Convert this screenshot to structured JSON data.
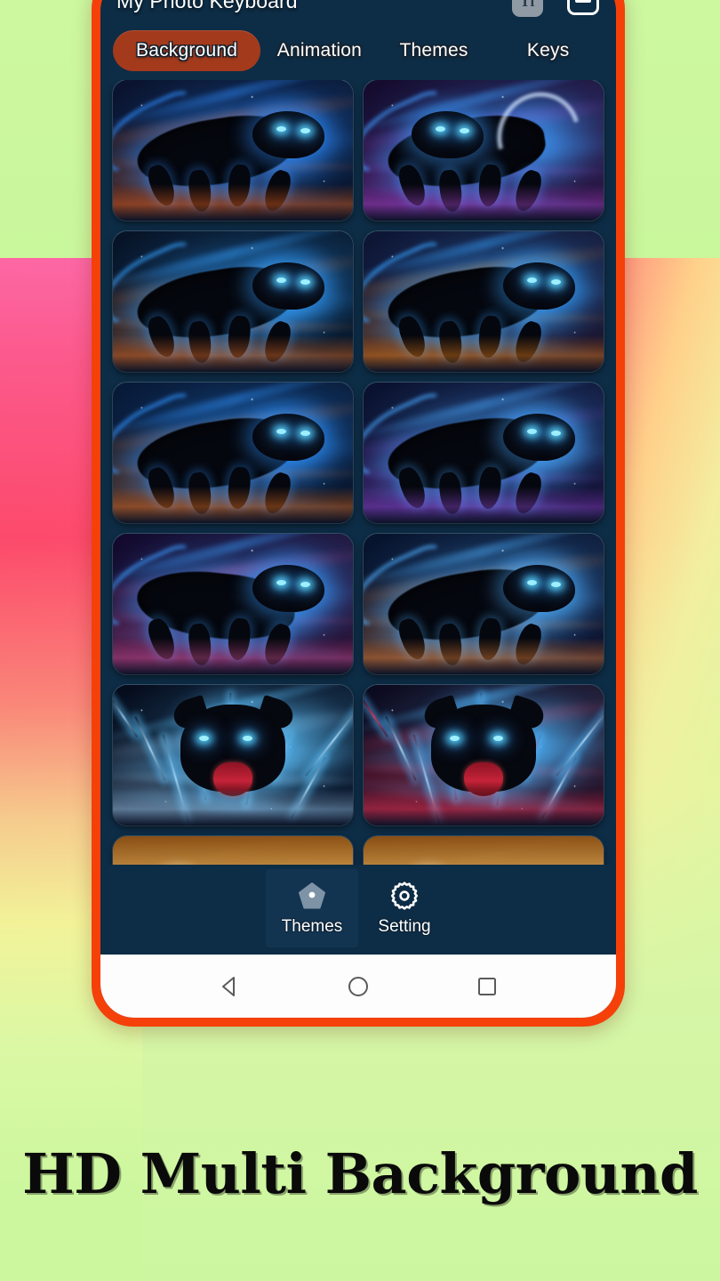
{
  "app": {
    "title": "My Photo Keyboard",
    "font_size_button_label": "Tf",
    "menu_icon": "hamburger-menu-icon",
    "font_icon": "font-size-icon"
  },
  "tabs": [
    {
      "label": "Background",
      "active": true
    },
    {
      "label": "Animation",
      "active": false
    },
    {
      "label": "Themes",
      "active": false
    },
    {
      "label": "Keys",
      "active": false
    }
  ],
  "grid": {
    "columns": 2,
    "items": [
      {
        "name": "neon-blue-panther-leaping",
        "sky_from": "#0a1430",
        "sky_to": "#061024",
        "glow": "#2f8dff",
        "accent": "#ff6a1e",
        "pose": "leap-right"
      },
      {
        "name": "cosmic-panther-crescent-moon",
        "sky_from": "#140b2e",
        "sky_to": "#2a0f3a",
        "glow": "#3f9dff",
        "accent": "#b24ad8",
        "pose": "moon"
      },
      {
        "name": "electric-panther-prowling",
        "sky_from": "#071428",
        "sky_to": "#04101f",
        "glow": "#35a0ff",
        "accent": "#ff7a2a",
        "pose": "prowl"
      },
      {
        "name": "fire-and-ice-panther",
        "sky_from": "#0d1636",
        "sky_to": "#1b0c22",
        "glow": "#36a2ff",
        "accent": "#ff8a18",
        "pose": "fire"
      },
      {
        "name": "blue-flame-panther-running",
        "sky_from": "#081b3a",
        "sky_to": "#060e20",
        "glow": "#2f93ff",
        "accent": "#ff7b22",
        "pose": "run"
      },
      {
        "name": "galaxy-panther-swirl",
        "sky_from": "#0a1230",
        "sky_to": "#120a2c",
        "glow": "#48a8ff",
        "accent": "#9a4de0",
        "pose": "swirl"
      },
      {
        "name": "nebula-panther-crouching",
        "sky_from": "#120a2e",
        "sky_to": "#2a0c2e",
        "glow": "#3b9dff",
        "accent": "#e0559a",
        "pose": "crouch"
      },
      {
        "name": "cosmic-panther-charging",
        "sky_from": "#07142e",
        "sky_to": "#0a0a24",
        "glow": "#4fb0ff",
        "accent": "#ff8f3a",
        "pose": "charge"
      },
      {
        "name": "lightning-panther-roaring",
        "sky_from": "#050c1c",
        "sky_to": "#081226",
        "glow": "#5fc4ff",
        "accent": "#a9d8ff",
        "pose": "roar"
      },
      {
        "name": "red-blue-lightning-panther-face",
        "sky_from": "#0a0a1e",
        "sky_to": "#2a0a1e",
        "glow": "#4fb8ff",
        "accent": "#ff3a5e",
        "pose": "roar-red"
      },
      {
        "name": "golden-panther-partial",
        "sky_from": "#6a3c10",
        "sky_to": "#e0a23c",
        "glow": "#ffd27a",
        "accent": "#ffbb44",
        "pose": "gold"
      },
      {
        "name": "golden-panther-partial-2",
        "sky_from": "#5e3410",
        "sky_to": "#f0c070",
        "glow": "#ffe0a0",
        "accent": "#ffcc55",
        "pose": "gold"
      }
    ]
  },
  "bottom_nav": {
    "items": [
      {
        "label": "Themes",
        "icon": "home-pentagon-icon",
        "selected": true
      },
      {
        "label": "Setting",
        "icon": "gear-icon",
        "selected": false
      }
    ]
  },
  "system_nav": {
    "back": "back-triangle-icon",
    "home": "home-circle-icon",
    "recents": "recents-square-icon"
  },
  "poster": {
    "headline": "HD Multi Background"
  },
  "colors": {
    "frame": "#f5400a",
    "app_bg": "#0d2c45",
    "active_tab": "#a33a1c",
    "nav_selected": "#123451",
    "green_floor": "#ccf79f"
  }
}
